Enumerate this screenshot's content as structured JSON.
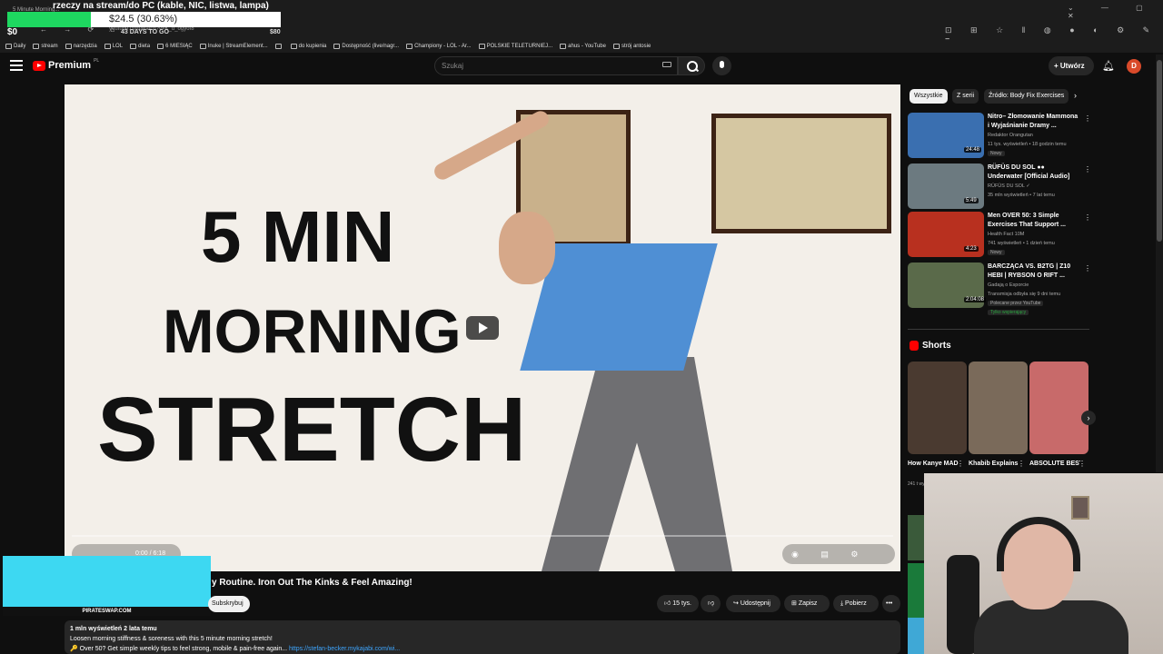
{
  "overlay": {
    "title": "rzeczy na stream/do PC (kable, NIC, listwa, lampa)",
    "tab_text": "5 Minute Morning...",
    "amount": "$24.5 (30.63%)",
    "current": "$0",
    "days_left": "43 DAYS TO GO",
    "goal": "$80",
    "progress_fraction": 0.3063
  },
  "browser": {
    "url": "youtube.com/watch?v=K_d_ogyof8",
    "bookmarks": [
      "Daily",
      "stream",
      "narzędzia",
      "LOL",
      "dieta",
      "6 MIESIĄC",
      "Inuke | StreamElement...",
      "",
      "do kupienia",
      "Dostępność (live/nagr...",
      "Championy - LOL - Ar...",
      "POLSKIE TELETURNIEJ...",
      "ahus - YouTube",
      "strój antosie"
    ]
  },
  "header": {
    "logo_text": "Premium",
    "logo_region": "PL",
    "search_placeholder": "Szukaj",
    "create_label": "Utwórz",
    "avatar_letter": "D"
  },
  "video": {
    "thumb_line1": "5 MIN",
    "thumb_line2": "MORNING",
    "thumb_line3": "STRETCH",
    "time": "0:00 / 6:18",
    "title": "y Routine. Iron Out The Kinks & Feel Amazing!",
    "subscribe_label": "Subskrybuj",
    "likes": "15 tys.",
    "share_label": "Udostępnij",
    "save_label": "Zapisz",
    "download_label": "Pobierz",
    "more_label": "•••"
  },
  "description": {
    "meta": "1 mln wyświetleń  2 lata temu",
    "line1": "Loosen morning stiffness & soreness with this 5 minute morning stretch!",
    "line2": "🔑 Over 50? Get simple weekly tips to feel strong, mobile & pain-free again... ",
    "link": "https://stefan-becker.mykajabi.com/wi..."
  },
  "stream_overlay": {
    "label": "PIRATESWAP.COM"
  },
  "chips": [
    "Wszystkie",
    "Z serii",
    "Źródło: Body Fix Exercises"
  ],
  "recommendations": [
    {
      "title": "Nitro– Złomowanie Mammona i Wyjaśnianie Dramy ...",
      "channel": "Redaktor Orangutan",
      "meta": "11 tys. wyświetleń • 18 godzin temu",
      "badge": "Nowy",
      "duration": "24:48",
      "color": "#3a6fb0"
    },
    {
      "title": "RÜFÜS DU SOL ●● Underwater [Official Audio]",
      "channel": "RÜFÜS DU SOL ✓",
      "meta": "35 mln wyświetleń • 7 lat temu",
      "badge": "",
      "duration": "5:49",
      "color": "#6c7a80"
    },
    {
      "title": "Men OVER 50: 3 Simple Exercises That Support ...",
      "channel": "Health Fact 10M",
      "meta": "741 wyświetleń • 1 dzień temu",
      "badge": "Nowy",
      "duration": "4:23",
      "color": "#b8301f"
    },
    {
      "title": "BARCZĄCA VS. B2TG | Z10 HEBI | RYBSON O RIFT ...",
      "channel": "Gadają o Esporcie",
      "meta": "Transmisja odbyła się 9 dni temu",
      "badge": "Polecane przez YouTube",
      "duration": "2:04:08",
      "color": "#5a6a4a",
      "extra": "Tylko wspierający"
    }
  ],
  "shorts": {
    "heading": "Shorts",
    "items": [
      {
        "title": "How Kanye MADE BAC...",
        "color": "#4a3a30"
      },
      {
        "title": "Khabib Explains W...",
        "color": "#7a6a5a"
      },
      {
        "title": "ABSOLUTE BEST Glute...",
        "color": "#c86a6a"
      }
    ],
    "meta": "241 t wyśw"
  },
  "colors": {
    "accent": "#ff0000",
    "bg": "#0f0f0f",
    "chip": "#272727",
    "link": "#3ea6ff",
    "overlay_green": "#1ed760",
    "stream_cyan": "#3dd8f2"
  }
}
